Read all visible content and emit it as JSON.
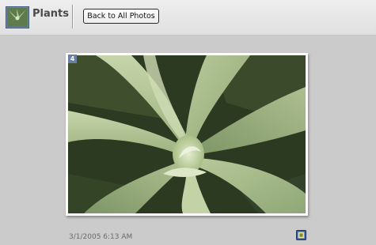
{
  "header": {
    "album_title": "Plants",
    "album_icon": "plant-thumbnail-icon",
    "back_button_label": "Back to All Photos"
  },
  "photo": {
    "number_badge": "4",
    "date": "3/1/2005 6:13 AM",
    "details_icon": "photo-details-icon"
  },
  "colors": {
    "topbar_background": "#e6e6e6",
    "page_background": "#cbcbcb",
    "badge_background": "#6a7fa6"
  }
}
